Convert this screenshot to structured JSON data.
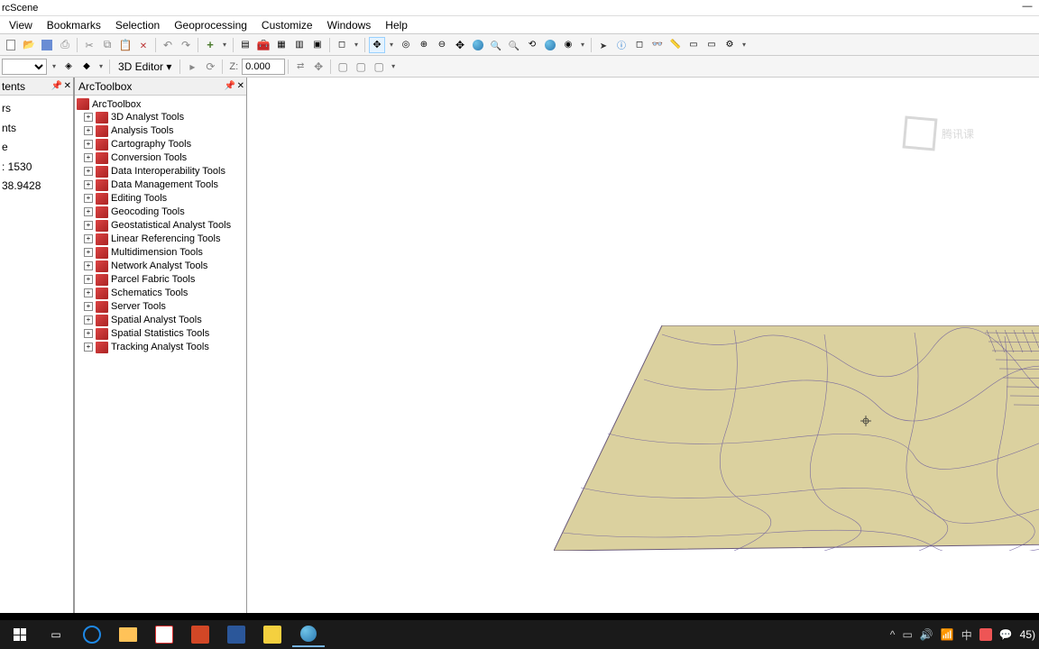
{
  "window": {
    "title": "rcScene"
  },
  "menubar": [
    "View",
    "Bookmarks",
    "Selection",
    "Geoprocessing",
    "Customize",
    "Windows",
    "Help"
  ],
  "editor": {
    "label": "3D Editor",
    "z_label": "Z:",
    "z_value": "0.000"
  },
  "left_panel": {
    "title": "tents",
    "items": [
      "rs",
      "",
      "",
      "",
      "",
      "",
      "nts",
      "",
      "",
      "e",
      ": 1530",
      "",
      "38.9428"
    ]
  },
  "toolbox": {
    "title": "ArcToolbox",
    "root": "ArcToolbox",
    "items": [
      "3D Analyst Tools",
      "Analysis Tools",
      "Cartography Tools",
      "Conversion Tools",
      "Data Interoperability Tools",
      "Data Management Tools",
      "Editing Tools",
      "Geocoding Tools",
      "Geostatistical Analyst Tools",
      "Linear Referencing Tools",
      "Multidimension Tools",
      "Network Analyst Tools",
      "Parcel Fabric Tools",
      "Schematics Tools",
      "Server Tools",
      "Spatial Analyst Tools",
      "Spatial Statistics Tools",
      "Tracking Analyst Tools"
    ]
  },
  "watermark": "腾讯课",
  "tray": {
    "ime": "中",
    "time": "45)"
  }
}
